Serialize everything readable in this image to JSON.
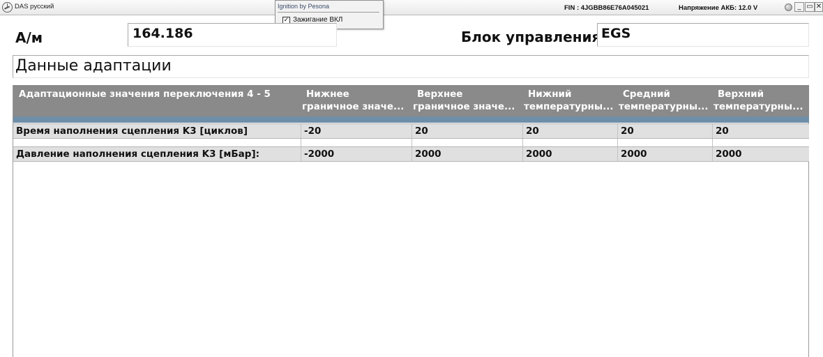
{
  "titlebar": {
    "app_title": "DAS русский",
    "fin": "FIN : 4JGBB86E76A045021",
    "voltage": "Напряжение АКБ: 12.0 V",
    "min_label": "_",
    "max_label": "▭",
    "close_label": "✕"
  },
  "ignition": {
    "title": "Ignition by Pesona",
    "checked_mark": "✓",
    "label": "Зажигание ВКЛ"
  },
  "header": {
    "am_label": "А/м",
    "am_value": "164.186",
    "block_label": "Блок управления",
    "block_value": "EGS"
  },
  "section": {
    "title": "Данные адаптации"
  },
  "table": {
    "columns": [
      {
        "line1": "Адаптационные значения переключения 4 - 5",
        "line2": ""
      },
      {
        "line1": "Нижнее",
        "line2": "граничное значе..."
      },
      {
        "line1": "Верхнее",
        "line2": "граничное значе..."
      },
      {
        "line1": "Нижний",
        "line2": "температурны..."
      },
      {
        "line1": "Средний",
        "line2": "температурны..."
      },
      {
        "line1": "Верхний",
        "line2": "температурны..."
      }
    ],
    "rows": [
      [
        "Время наполнения сцепления K3 [циклов]",
        "-20",
        "20",
        "20",
        "20",
        "20"
      ],
      [
        "Давление наполнения сцепления K3 [мБар]:",
        "-2000",
        "2000",
        "2000",
        "2000",
        "2000"
      ]
    ]
  }
}
